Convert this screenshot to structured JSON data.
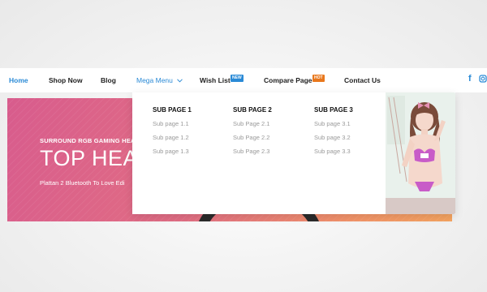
{
  "nav": {
    "items": [
      {
        "label": "Home",
        "active": true
      },
      {
        "label": "Shop Now"
      },
      {
        "label": "Blog"
      },
      {
        "label": "Mega Menu",
        "has_dropdown": true,
        "open": true
      },
      {
        "label": "Wish List",
        "badge": "NEW"
      },
      {
        "label": "Compare Page",
        "badge": "HOT"
      },
      {
        "label": "Contact Us"
      }
    ],
    "social": [
      "facebook-icon",
      "instagram-icon"
    ]
  },
  "banner": {
    "subtitle": "SURROUND RGB GAMING HEADS",
    "title": "TOP HEAD",
    "description": "Plattan 2 Bluetooth To Love Edi"
  },
  "mega_menu": {
    "columns": [
      {
        "title": "SUB PAGE 1",
        "links": [
          "Sub page 1.1",
          "Sub page 1.2",
          "Sub page 1.3"
        ]
      },
      {
        "title": "SUB PAGE 2",
        "links": [
          "Sub Page 2.1",
          "Sub Page 2.2",
          "Sub Page 2.3"
        ]
      },
      {
        "title": "SUB PAGE 3",
        "links": [
          "Sub page 3.1",
          "Sub page 3.2",
          "Sub page 3.3"
        ]
      }
    ],
    "promo_image": "promo-model-image"
  },
  "colors": {
    "accent": "#2a8ad6",
    "badge_new": "#2a8ad6",
    "badge_hot": "#e8771c",
    "banner_start": "#d85c8d",
    "banner_end": "#f5a35f"
  }
}
